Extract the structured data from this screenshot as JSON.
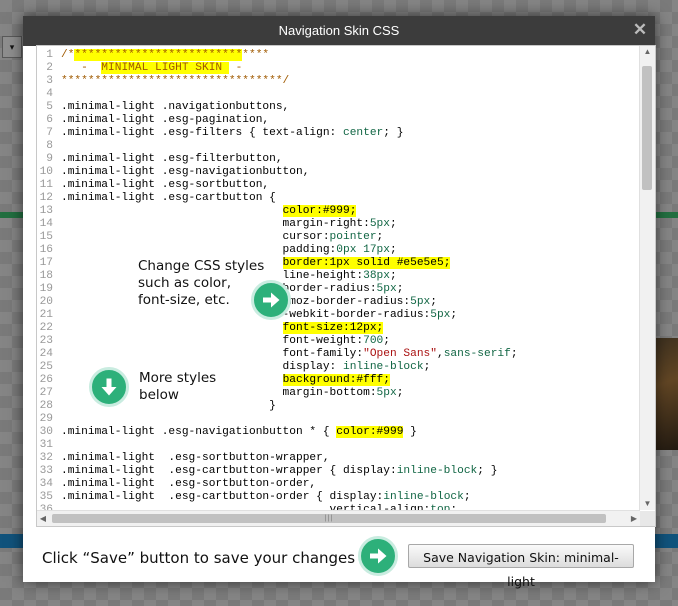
{
  "background": {
    "select_glyph": "▾"
  },
  "dialog": {
    "title": "Navigation Skin CSS",
    "close_glyph": "✕"
  },
  "code_lines": [
    [
      [
        "/*",
        "c-com"
      ],
      [
        "*************************",
        "c-com hl"
      ],
      [
        "****",
        "c-com"
      ]
    ],
    [
      [
        "   -  ",
        "c-com"
      ],
      [
        "MINIMAL LIGHT SKIN ",
        "c-com hl"
      ],
      [
        " -",
        "c-com"
      ]
    ],
    [
      [
        "*********************************/",
        "c-com"
      ]
    ],
    [],
    [
      [
        ".minimal-light .navigationbuttons,",
        ""
      ]
    ],
    [
      [
        ".minimal-light .esg-pagination,",
        ""
      ]
    ],
    [
      [
        ".minimal-light .esg-filters { text-align: ",
        ""
      ],
      [
        "center",
        "c-val"
      ],
      [
        "; }",
        ""
      ]
    ],
    [],
    [
      [
        ".minimal-light .esg-filterbutton,",
        ""
      ]
    ],
    [
      [
        ".minimal-light .esg-navigationbutton,",
        ""
      ]
    ],
    [
      [
        ".minimal-light .esg-sortbutton,",
        ""
      ]
    ],
    [
      [
        ".minimal-light .esg-cartbutton {",
        ""
      ]
    ],
    [
      [
        "                                 ",
        ""
      ],
      [
        "color:#999;",
        "hl"
      ]
    ],
    [
      [
        "                                 margin-right:",
        ""
      ],
      [
        "5px",
        "c-num"
      ],
      [
        ";",
        ""
      ]
    ],
    [
      [
        "                                 cursor:",
        ""
      ],
      [
        "pointer",
        "c-val"
      ],
      [
        ";",
        ""
      ]
    ],
    [
      [
        "                                 padding:",
        ""
      ],
      [
        "0px 17px",
        "c-num"
      ],
      [
        ";",
        ""
      ]
    ],
    [
      [
        "                                 ",
        ""
      ],
      [
        "border:1px solid #e5e5e5;",
        "hl"
      ]
    ],
    [
      [
        "                                 line-height:",
        ""
      ],
      [
        "38px",
        "c-num"
      ],
      [
        ";",
        ""
      ]
    ],
    [
      [
        "                                 border-radius:",
        ""
      ],
      [
        "5px",
        "c-num"
      ],
      [
        ";",
        ""
      ]
    ],
    [
      [
        "                                 -moz-border-radius:",
        ""
      ],
      [
        "5px",
        "c-num"
      ],
      [
        ";",
        ""
      ]
    ],
    [
      [
        "                                 -webkit-border-radius:",
        ""
      ],
      [
        "5px",
        "c-num"
      ],
      [
        ";",
        ""
      ]
    ],
    [
      [
        "                                 ",
        ""
      ],
      [
        "font-size:12px;",
        "hl"
      ]
    ],
    [
      [
        "                                 font-weight:",
        ""
      ],
      [
        "700",
        "c-num"
      ],
      [
        ";",
        ""
      ]
    ],
    [
      [
        "                                 font-family:",
        ""
      ],
      [
        "\"Open Sans\"",
        "c-str"
      ],
      [
        ",",
        ""
      ],
      [
        "sans-serif",
        "c-val"
      ],
      [
        ";",
        ""
      ]
    ],
    [
      [
        "                                 display: ",
        ""
      ],
      [
        "inline-block",
        "c-val"
      ],
      [
        ";",
        ""
      ]
    ],
    [
      [
        "                                 ",
        ""
      ],
      [
        "background:#fff;",
        "hl"
      ]
    ],
    [
      [
        "                                 margin-bottom:",
        ""
      ],
      [
        "5px",
        "c-num"
      ],
      [
        ";",
        ""
      ]
    ],
    [
      [
        "                               }",
        ""
      ]
    ],
    [],
    [
      [
        ".minimal-light .esg-navigationbutton * { ",
        ""
      ],
      [
        "color:#999",
        "hl"
      ],
      [
        " }",
        ""
      ]
    ],
    [],
    [
      [
        ".minimal-light  .esg-sortbutton-wrapper,",
        ""
      ]
    ],
    [
      [
        ".minimal-light  .esg-cartbutton-wrapper { display:",
        ""
      ],
      [
        "inline-block",
        "c-val"
      ],
      [
        "; }",
        ""
      ]
    ],
    [
      [
        ".minimal-light  .esg-sortbutton-order,",
        ""
      ]
    ],
    [
      [
        ".minimal-light  .esg-cartbutton-order { display:",
        ""
      ],
      [
        "inline-block",
        "c-val"
      ],
      [
        ";",
        ""
      ]
    ],
    [
      [
        "                                        vertical-align:",
        ""
      ],
      [
        "top",
        "c-val"
      ],
      [
        ";",
        ""
      ]
    ],
    []
  ],
  "annotations": {
    "css_styles_text": [
      "Change CSS styles",
      "such as color,",
      "font-size, etc."
    ],
    "more_styles_text": [
      "More styles",
      "below"
    ]
  },
  "scroll": {
    "up": "▲",
    "down": "▼",
    "left": "◀",
    "right": "▶",
    "grip": "|||"
  },
  "footer": {
    "hint": "Click “Save” button to save your changes",
    "save_button_label": "Save Navigation Skin: minimal-light"
  },
  "colors": {
    "highlight": "#ffff00",
    "accent": "#2db07a",
    "titlebar": "#3c3c3c"
  },
  "icons": {
    "arrow_right": "arrow-right-circle-icon",
    "arrow_down": "arrow-down-circle-icon"
  }
}
